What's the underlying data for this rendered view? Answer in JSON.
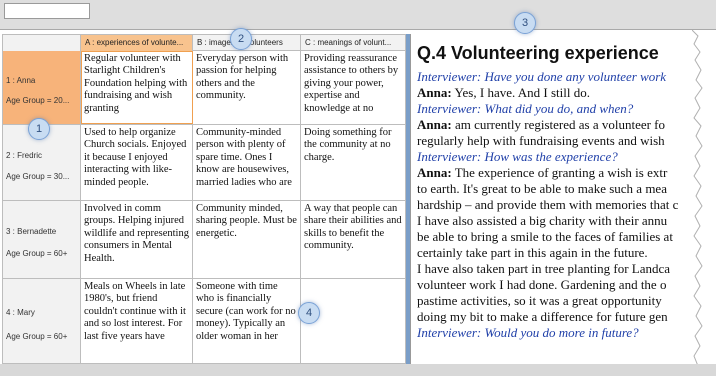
{
  "matrix": {
    "columns": [
      {
        "label": "A : experiences of volunte..."
      },
      {
        "label": "B : images of volunteers"
      },
      {
        "label": "C : meanings of volunt..."
      }
    ],
    "rows": [
      {
        "name": "1 : Anna",
        "age": "Age Group = 20...",
        "a": "Regular volunteer with Starlight Children's Foundation helping with fundraising and wish granting",
        "b": "Everyday person with passion for helping others and the community.",
        "c": "Providing reassurance assistance to others by giving your power, expertise and knowledge at no"
      },
      {
        "name": "2 : Fredric",
        "age": "Age Group = 30...",
        "a": "Used to help organize Church socials. Enjoyed it because I enjoyed interacting with like-minded people.",
        "b": "Community-minded person with plenty of spare time. Ones I know are housewives, married ladies who are",
        "c": "Doing something for the community at no charge."
      },
      {
        "name": "3 : Bernadette",
        "age": "Age Group = 60+",
        "a": "Involved in comm groups. Helping injured wildlife and representing consumers in Mental Health.",
        "b": "Community minded, sharing people. Must be energetic.",
        "c": "A way that people can share their abilities and skills to benefit the community."
      },
      {
        "name": "4 : Mary",
        "age": "Age Group = 60+",
        "a": "Meals on Wheels in late 1980's, but friend couldn't continue with it and so lost interest. For last five years have",
        "b": "Someone with time who is financially secure (can work for no money). Typically an older woman in her",
        "c": ""
      }
    ]
  },
  "document": {
    "title": "Q.4 Volunteering experience",
    "lines": [
      {
        "type": "question",
        "text": "Interviewer: Have you done any volunteer work"
      },
      {
        "type": "answer",
        "speaker": "Anna:",
        "text": " Yes, I have. And I still do."
      },
      {
        "type": "question",
        "text": "Interviewer: What did you do, and when?"
      },
      {
        "type": "answer",
        "speaker": "Anna:",
        "text": "  am currently registered as a volunteer fo"
      },
      {
        "type": "plain",
        "text": "regularly help with fundraising events and wish"
      },
      {
        "type": "question",
        "text": "Interviewer: How was the experience?"
      },
      {
        "type": "answer",
        "speaker": "Anna:",
        "text": " The experience of granting a wish is extr"
      },
      {
        "type": "plain",
        "text": "to earth. It's great to be able to make such a mea"
      },
      {
        "type": "plain",
        "text": "hardship – and provide them with memories that c"
      },
      {
        "type": "plain",
        "text": "I have also assisted a big charity with their annu"
      },
      {
        "type": "plain",
        "text": "be able to bring a smile to the faces of families at"
      },
      {
        "type": "plain",
        "text": "certainly take part in this again in the future."
      },
      {
        "type": "plain",
        "text": "I have also taken part in tree planting for Landca"
      },
      {
        "type": "plain",
        "text": "volunteer work I had done. Gardening and the o"
      },
      {
        "type": "plain",
        "text": "pastime activities, so it was a great opportunity"
      },
      {
        "type": "plain",
        "text": "doing my bit to make a difference for future gen"
      },
      {
        "type": "question",
        "text": "Interviewer: Would you do more in future?"
      }
    ]
  },
  "callouts": [
    "1",
    "2",
    "3",
    "4"
  ],
  "colors": {
    "selected_header": "#f8c38e",
    "selected_row": "#f7b37a",
    "question_text": "#1f3fa8",
    "splitter": "#7a9ec8",
    "callout_fill": "#c8dcf2"
  }
}
